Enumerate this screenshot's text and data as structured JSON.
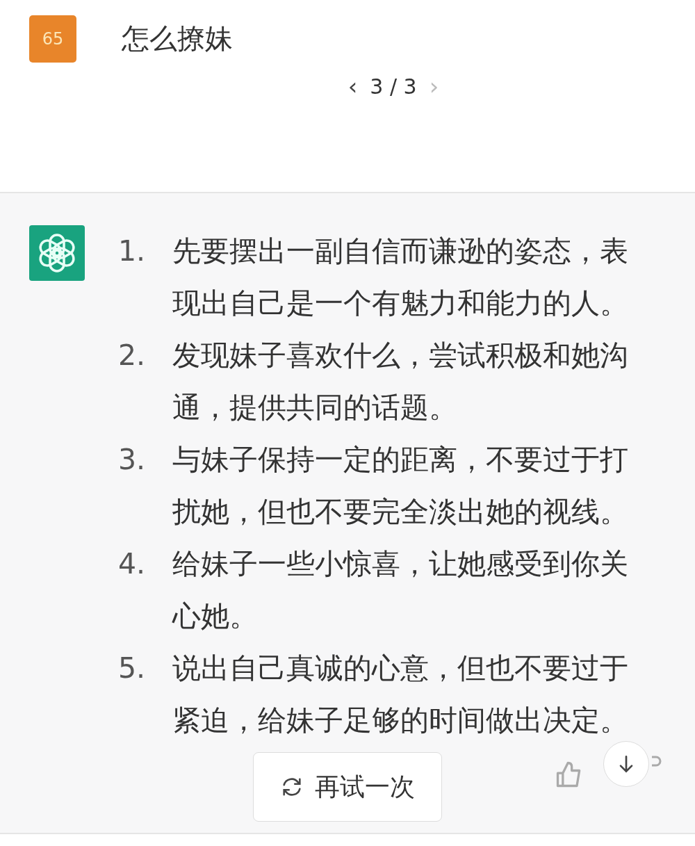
{
  "question": {
    "avatar": "65",
    "text": "怎么撩妹"
  },
  "pager": {
    "prev": "‹",
    "current": "3 / 3",
    "next": "›",
    "prev_disabled": false,
    "next_disabled": true
  },
  "answer": {
    "items": [
      {
        "number": "1.",
        "text": "先要摆出一副自信而谦逊的姿态，表现出自己是一个有魅力和能力的人。"
      },
      {
        "number": "2.",
        "text": "发现妹子喜欢什么，尝试积极和她沟通，提供共同的话题。"
      },
      {
        "number": "3.",
        "text": "与妹子保持一定的距离，不要过于打扰她，但也不要完全淡出她的视线。"
      },
      {
        "number": "4.",
        "text": "给妹子一些小惊喜，让她感受到你关心她。"
      },
      {
        "number": "5.",
        "text": "说出自己真诚的心意，但也不要过于紧迫，给妹子足够的时间做出决定。"
      }
    ]
  },
  "retry_button": {
    "label": "再试一次"
  }
}
